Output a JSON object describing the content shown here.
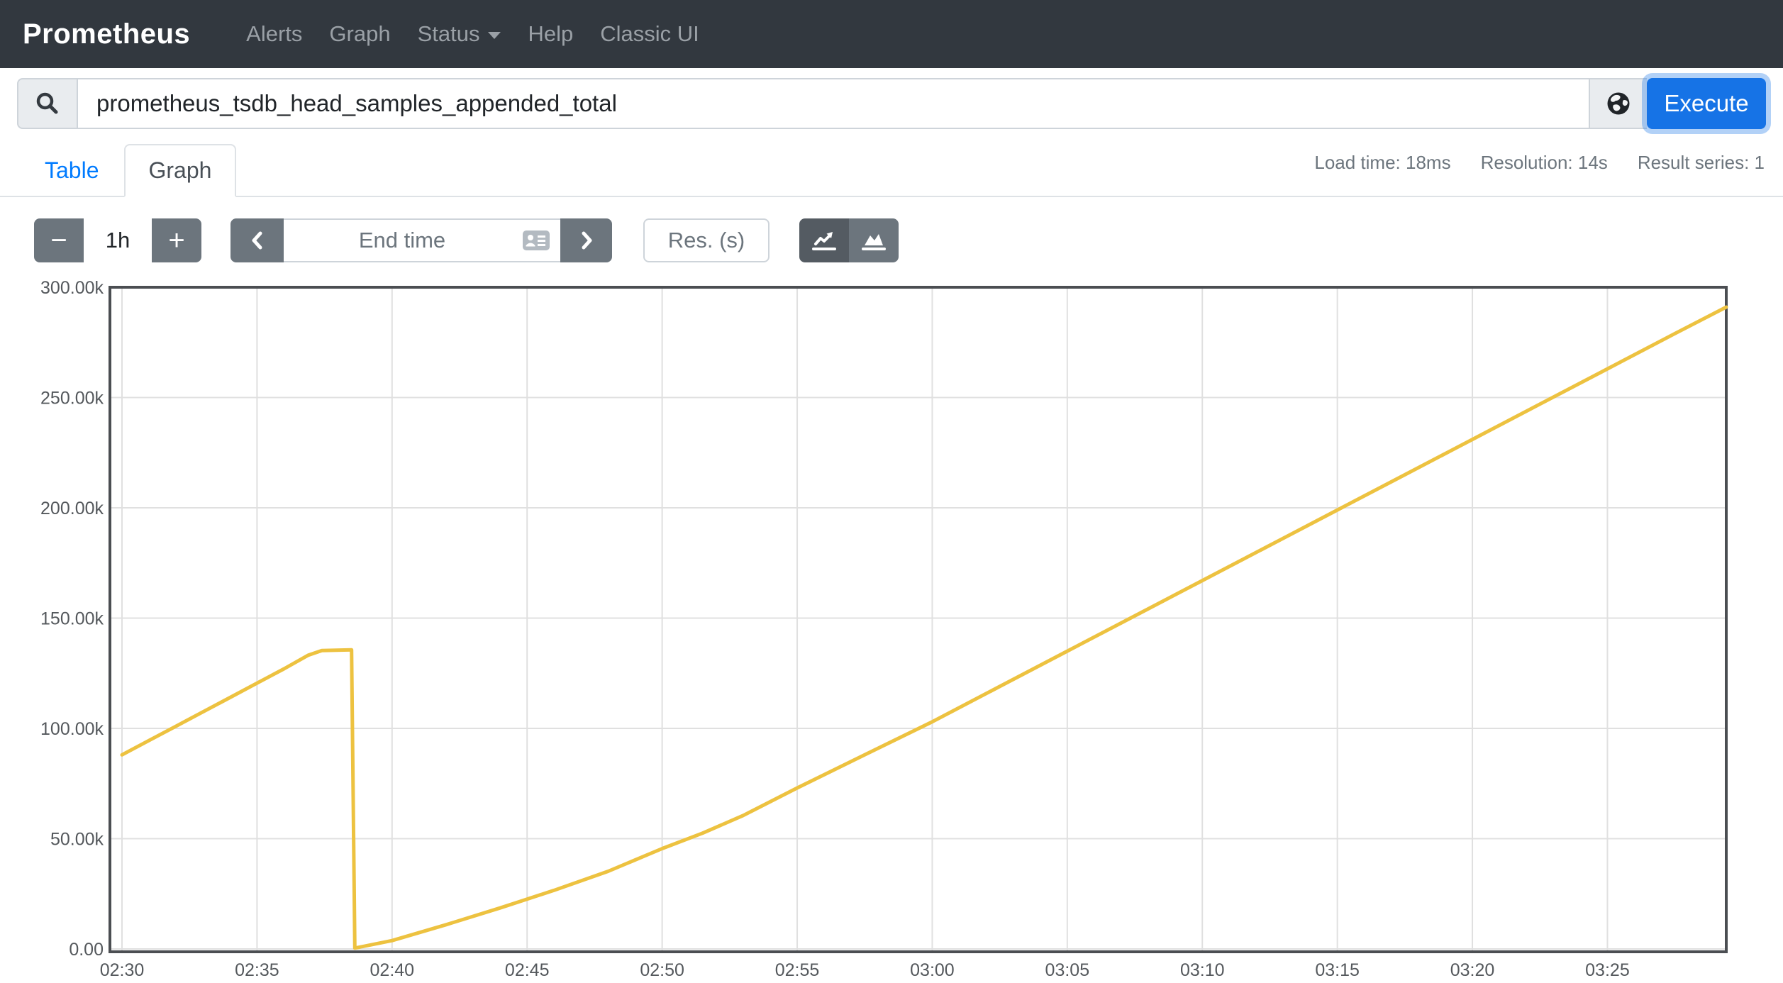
{
  "navbar": {
    "brand": "Prometheus",
    "items": [
      {
        "label": "Alerts"
      },
      {
        "label": "Graph"
      },
      {
        "label": "Status",
        "has_dropdown": true
      },
      {
        "label": "Help"
      },
      {
        "label": "Classic UI"
      }
    ]
  },
  "query_bar": {
    "value": "prometheus_tsdb_head_samples_appended_total",
    "execute_label": "Execute",
    "icons": {
      "prefix": "search-icon",
      "explorer": "globe-icon"
    }
  },
  "stats": {
    "load_time": "Load time: 18ms",
    "resolution": "Resolution: 14s",
    "result_series": "Result series: 1"
  },
  "tabs": [
    {
      "label": "Table",
      "active": false
    },
    {
      "label": "Graph",
      "active": true
    }
  ],
  "controls": {
    "duration": {
      "decrease": "−",
      "value": "1h",
      "increase": "+"
    },
    "endtime_placeholder": "End time",
    "res_placeholder": "Res. (s)",
    "icons": {
      "prev": "chevron-left-icon",
      "endtime": "calendar-icon",
      "next": "chevron-right-icon",
      "line_mode": "chart-line-icon",
      "stacked_mode": "chart-area-icon"
    }
  },
  "colors": {
    "navbar_bg": "#32383f",
    "primary_button": "#1673e6",
    "secondary_button": "#6c757d",
    "active_toggle": "#545b62",
    "tab_link": "#007bff",
    "grid": "#e0e0e0",
    "plot_border": "#4b4e52",
    "tick_text": "#54585c"
  },
  "chart_data": {
    "type": "line",
    "title": "",
    "xlabel": "",
    "ylabel": "",
    "x_start_time": "02:30",
    "x_range_minutes": [
      0,
      59.4
    ],
    "y_range": [
      0,
      300000
    ],
    "grid": true,
    "legend_position": "none",
    "x_ticks": [
      {
        "min": 0,
        "label": "02:30"
      },
      {
        "min": 5,
        "label": "02:35"
      },
      {
        "min": 10,
        "label": "02:40"
      },
      {
        "min": 15,
        "label": "02:45"
      },
      {
        "min": 20,
        "label": "02:50"
      },
      {
        "min": 25,
        "label": "02:55"
      },
      {
        "min": 30,
        "label": "03:00"
      },
      {
        "min": 35,
        "label": "03:05"
      },
      {
        "min": 40,
        "label": "03:10"
      },
      {
        "min": 45,
        "label": "03:15"
      },
      {
        "min": 50,
        "label": "03:20"
      },
      {
        "min": 55,
        "label": "03:25"
      }
    ],
    "y_ticks": [
      {
        "value": 0,
        "label": "0.00"
      },
      {
        "value": 50000,
        "label": "50.00k"
      },
      {
        "value": 100000,
        "label": "100.00k"
      },
      {
        "value": 150000,
        "label": "150.00k"
      },
      {
        "value": 200000,
        "label": "200.00k"
      },
      {
        "value": 250000,
        "label": "250.00k"
      },
      {
        "value": 300000,
        "label": "300.00k"
      }
    ],
    "series": [
      {
        "name": "prometheus_tsdb_head_samples_appended_total",
        "color": "#EDC240",
        "points_min_value": [
          [
            0,
            88000
          ],
          [
            1,
            94500
          ],
          [
            2,
            101000
          ],
          [
            3,
            107500
          ],
          [
            4,
            114000
          ],
          [
            5,
            120500
          ],
          [
            6,
            127000
          ],
          [
            6.9,
            133200
          ],
          [
            7.4,
            135300
          ],
          [
            8.5,
            135600
          ],
          [
            8.62,
            400
          ],
          [
            10,
            3800
          ],
          [
            12,
            11000
          ],
          [
            14,
            18600
          ],
          [
            16,
            26600
          ],
          [
            18,
            35200
          ],
          [
            20,
            45500
          ],
          [
            21.5,
            52500
          ],
          [
            23,
            60500
          ],
          [
            25,
            73000
          ],
          [
            27.5,
            88000
          ],
          [
            30,
            103000
          ],
          [
            32.5,
            119000
          ],
          [
            35,
            135000
          ],
          [
            37.5,
            151000
          ],
          [
            40,
            167000
          ],
          [
            42.5,
            183000
          ],
          [
            45,
            199000
          ],
          [
            47.5,
            215000
          ],
          [
            50,
            231000
          ],
          [
            52.5,
            247000
          ],
          [
            55,
            263000
          ],
          [
            57.5,
            279000
          ],
          [
            59.4,
            291000
          ]
        ]
      }
    ]
  }
}
